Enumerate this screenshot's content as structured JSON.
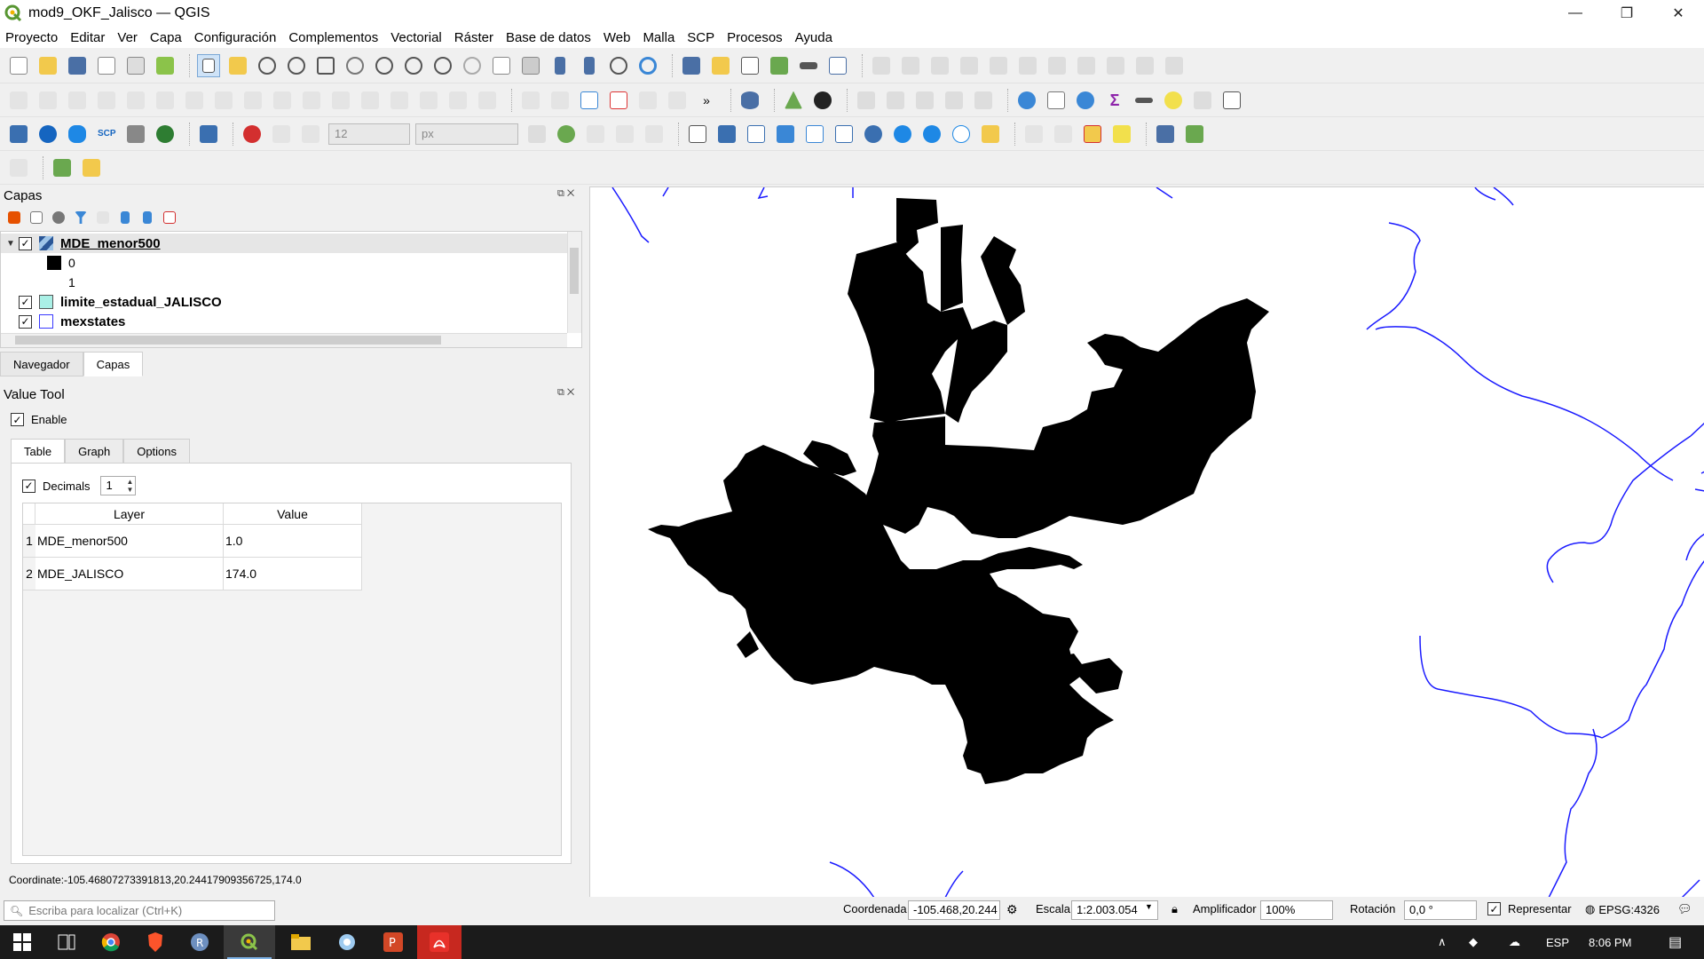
{
  "window": {
    "title": "mod9_OKF_Jalisco — QGIS",
    "minimize": "—",
    "restore": "❐",
    "close": "✕"
  },
  "menu": [
    "Proyecto",
    "Editar",
    "Ver",
    "Capa",
    "Configuración",
    "Complementos",
    "Vectorial",
    "Ráster",
    "Base de datos",
    "Web",
    "Malla",
    "SCP",
    "Procesos",
    "Ayuda"
  ],
  "toolbar3": {
    "size_value": "12",
    "unit_value": "px",
    "scp_label": "SCP"
  },
  "layers_panel": {
    "title": "Capas",
    "layers": [
      {
        "name": "MDE_menor500",
        "checked": true,
        "expanded": true,
        "legend": [
          "0",
          "1"
        ]
      },
      {
        "name": "limite_estadual_JALISCO",
        "checked": true
      },
      {
        "name": "mexstates",
        "checked": true
      }
    ]
  },
  "panel_tabs": [
    "Navegador",
    "Capas"
  ],
  "value_tool": {
    "title": "Value Tool",
    "enable_label": "Enable",
    "tabs": [
      "Table",
      "Graph",
      "Options"
    ],
    "decimals_label": "Decimals",
    "decimals_value": "1",
    "columns": [
      "Layer",
      "Value"
    ],
    "rows": [
      {
        "num": "1",
        "layer": "MDE_menor500",
        "value": "1.0"
      },
      {
        "num": "2",
        "layer": "MDE_JALISCO",
        "value": "174.0"
      }
    ],
    "coordinate_text": "Coordinate:-105.46807273391813,20.24417909356725,174.0"
  },
  "statusbar": {
    "locator_placeholder": "Escriba para localizar (Ctrl+K)",
    "coord_label": "Coordenada",
    "coord_value": "-105.468,20.244",
    "scale_label": "Escala",
    "scale_value": "1:2.003.054",
    "magnifier_label": "Amplificador",
    "magnifier_value": "100%",
    "rotation_label": "Rotación",
    "rotation_value": "0,0 °",
    "render_label": "Representar",
    "crs": "EPSG:4326"
  },
  "taskbar": {
    "language": "ESP",
    "time": "8:06 PM"
  },
  "colors": {
    "raster_fill": "#000000",
    "state_lines": "#1a1aff",
    "accent": "#3b8f2e"
  }
}
